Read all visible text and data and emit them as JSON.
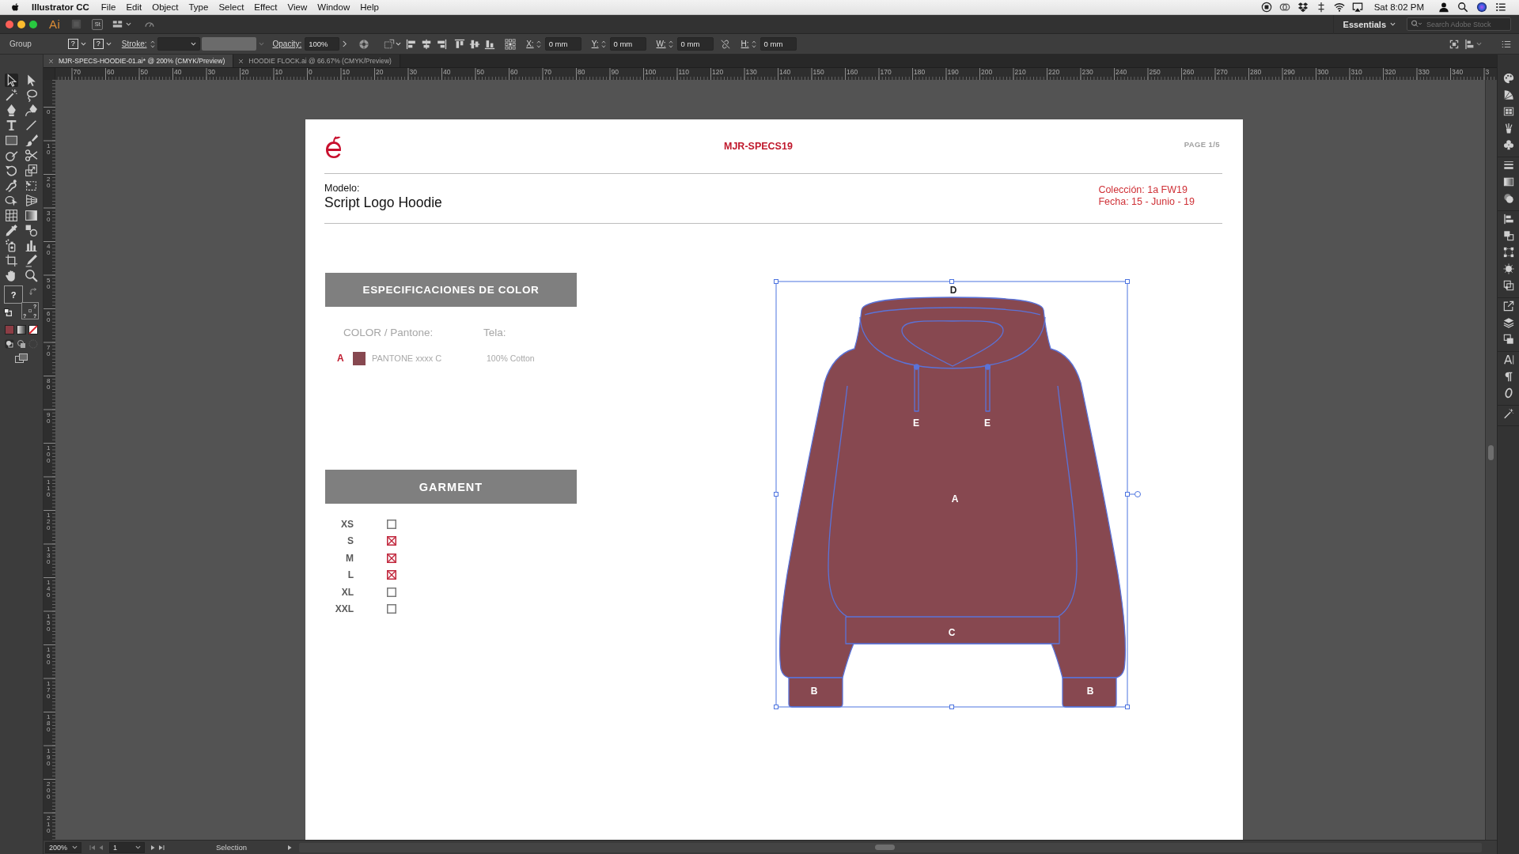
{
  "menu_bar": {
    "app_name": "Illustrator CC",
    "menus": [
      "File",
      "Edit",
      "Object",
      "Type",
      "Select",
      "Effect",
      "View",
      "Window",
      "Help"
    ],
    "clock": "Sat 8:02 PM"
  },
  "app_bar": {
    "logo": "Ai",
    "stock": "St",
    "workspace": "Essentials",
    "search": {
      "placeholder": "Search Adobe Stock"
    }
  },
  "control_bar": {
    "selection": "Group",
    "fill": "?",
    "stroke": "?",
    "stroke_label": "Stroke:",
    "opacity_label": "Opacity:",
    "opacity": "100%",
    "transform": [
      {
        "label": "X:",
        "value": "0 mm"
      },
      {
        "label": "Y:",
        "value": "0 mm"
      },
      {
        "label": "W:",
        "value": "0 mm"
      },
      {
        "label": "H:",
        "value": "0 mm"
      }
    ]
  },
  "tabs": [
    {
      "title": "MJR-SPECS-HOODIE-01.ai* @ 200% (CMYK/Preview)",
      "selected": true
    },
    {
      "title": "HOODIE FLOCK.ai @ 66.67% (CMYK/Preview)",
      "selected": false
    }
  ],
  "rulers": {
    "horizontal": [
      "70",
      "60",
      "50",
      "40",
      "30",
      "20",
      "10",
      "0",
      "10",
      "20",
      "30",
      "40",
      "50",
      "60",
      "70",
      "80",
      "90",
      "100",
      "110",
      "120",
      "130",
      "140",
      "150",
      "160",
      "170",
      "180",
      "190",
      "200",
      "210",
      "220",
      "230",
      "240",
      "250",
      "260",
      "270",
      "280",
      "290",
      "300",
      "310",
      "320",
      "330",
      "340",
      "3"
    ],
    "vertical": [
      "0",
      "10",
      "20",
      "30",
      "40",
      "50",
      "60",
      "70",
      "80",
      "90",
      "100",
      "110",
      "120",
      "130",
      "140",
      "150",
      "160",
      "170",
      "180",
      "190",
      "200",
      "210"
    ]
  },
  "tools": [
    {
      "kind": "selection",
      "selected": true
    },
    {
      "kind": "direct",
      "selected": false
    },
    {
      "kind": "wand",
      "selected": false
    },
    {
      "kind": "lasso",
      "selected": false
    },
    {
      "kind": "pen",
      "selected": false
    },
    {
      "kind": "curvature",
      "selected": false
    },
    {
      "kind": "type",
      "selected": false
    },
    {
      "kind": "line",
      "selected": false
    },
    {
      "kind": "rectangle",
      "selected": false
    },
    {
      "kind": "brush",
      "selected": false
    },
    {
      "kind": "shaper",
      "selected": false
    },
    {
      "kind": "scissors",
      "selected": false
    },
    {
      "kind": "rotate",
      "selected": false
    },
    {
      "kind": "scale",
      "selected": false
    },
    {
      "kind": "warp",
      "selected": false
    },
    {
      "kind": "transform",
      "selected": false
    },
    {
      "kind": "builder",
      "selected": false
    },
    {
      "kind": "perspective",
      "selected": false
    },
    {
      "kind": "mesh",
      "selected": false
    },
    {
      "kind": "gradient",
      "selected": false
    },
    {
      "kind": "eyedropper",
      "selected": false
    },
    {
      "kind": "blend",
      "selected": false
    },
    {
      "kind": "sprayer",
      "selected": false
    },
    {
      "kind": "graph",
      "selected": false
    },
    {
      "kind": "artboard",
      "selected": false
    },
    {
      "kind": "knife",
      "selected": false
    },
    {
      "kind": "hand",
      "selected": false
    },
    {
      "kind": "zoom",
      "selected": false
    }
  ],
  "fill_stroke": {
    "fill": "?",
    "stroke": [
      "?",
      "?",
      "?"
    ]
  },
  "document": {
    "code": "MJR-SPECS19",
    "page": "PAGE 1/5",
    "model_label": "Modelo:",
    "model_name": "Script Logo Hoodie",
    "meta": [
      "Colección: 1a FW19",
      "Fecha: 15 - Junio - 19"
    ],
    "color_specs": {
      "title": "ESPECIFICACIONES DE COLOR",
      "headers": [
        "COLOR / Pantone:",
        "Tela:"
      ],
      "rows": [
        {
          "letter": "A",
          "pantone": "PANTONE xxxx C",
          "fabric": "100% Cotton",
          "color": "#874850"
        }
      ]
    },
    "garment": {
      "title": "GARMENT",
      "sizes": [
        {
          "label": "XS",
          "checked": false
        },
        {
          "label": "S",
          "checked": true
        },
        {
          "label": "M",
          "checked": true
        },
        {
          "label": "L",
          "checked": true
        },
        {
          "label": "XL",
          "checked": false
        },
        {
          "label": "XXL",
          "checked": false
        }
      ]
    },
    "hoodie": {
      "callouts": [
        "D",
        "E",
        "E",
        "A",
        "C",
        "B",
        "B"
      ],
      "selected": true
    }
  },
  "status_bar": {
    "zoom": "200%",
    "artboard": "1",
    "tool": "Selection"
  }
}
